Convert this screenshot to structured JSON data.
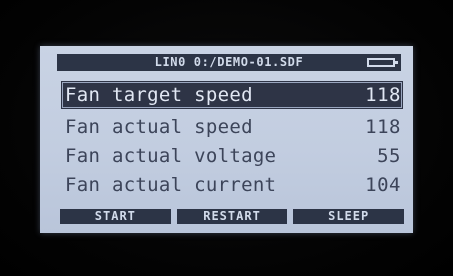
{
  "title_bar": {
    "text": "LIN0 0:/DEMO-01.SDF",
    "battery_icon": "battery-icon"
  },
  "rows": [
    {
      "label": "Fan target speed",
      "value": "118",
      "selected": true
    },
    {
      "label": "Fan actual speed",
      "value": "118",
      "selected": false
    },
    {
      "label": "Fan actual voltage",
      "value": "55",
      "selected": false
    },
    {
      "label": "Fan actual current",
      "value": "104",
      "selected": false
    }
  ],
  "softkeys": [
    "START",
    "RESTART",
    "SLEEP"
  ],
  "colors": {
    "lcd_background": "#c2cde0",
    "bar_dark": "#2c3446",
    "text": "#3c4459"
  }
}
